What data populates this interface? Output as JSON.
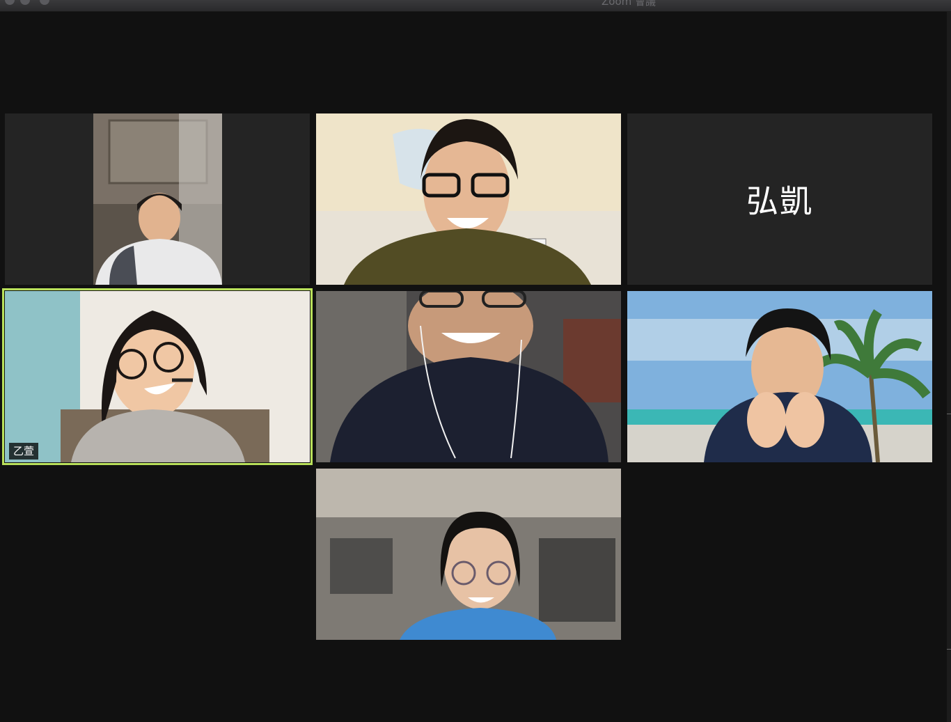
{
  "window": {
    "title": "Zoom 會議"
  },
  "participants": [
    {
      "id": "p1",
      "name": "",
      "video": true
    },
    {
      "id": "p2",
      "name": "",
      "video": true
    },
    {
      "id": "p3",
      "name": "弘凱",
      "video": false
    },
    {
      "id": "p4",
      "name": "乙萱",
      "video": true,
      "active_speaker": true
    },
    {
      "id": "p5",
      "name": "",
      "video": true
    },
    {
      "id": "p6",
      "name": "",
      "video": true
    },
    {
      "id": "p7",
      "name": "",
      "video": true
    }
  ],
  "colors": {
    "background": "#111111",
    "tile_background": "#242424",
    "active_speaker_border": "#b9e05a",
    "name_text": "#ffffff"
  }
}
